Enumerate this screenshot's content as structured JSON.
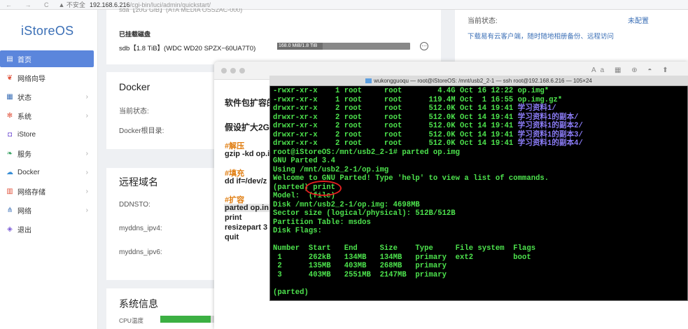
{
  "browser": {
    "nav": "← → C",
    "warning": "▲ 不安全",
    "url_host": "192.168.6.216",
    "url_path": "/cgi-bin/luci/admin/quickstart/"
  },
  "sidebar": {
    "logo": "iStoreOS",
    "items": [
      {
        "label": "首页",
        "icon": "home-icon",
        "glyph": "▤",
        "color": "#ffffff",
        "active": true,
        "chevron": false
      },
      {
        "label": "网络向导",
        "icon": "wizard-icon",
        "glyph": "❦",
        "color": "#e0513a",
        "active": false,
        "chevron": false
      },
      {
        "label": "状态",
        "icon": "status-icon",
        "glyph": "▦",
        "color": "#3b6fb6",
        "active": false,
        "chevron": true
      },
      {
        "label": "系统",
        "icon": "system-gear-icon",
        "glyph": "✻",
        "color": "#e0513a",
        "active": false,
        "chevron": true
      },
      {
        "label": "iStore",
        "icon": "istore-icon",
        "glyph": "◘",
        "color": "#7b5bd6",
        "active": false,
        "chevron": false
      },
      {
        "label": "服务",
        "icon": "service-icon",
        "glyph": "❧",
        "color": "#2e9d5b",
        "active": false,
        "chevron": true
      },
      {
        "label": "Docker",
        "icon": "docker-icon",
        "glyph": "☁",
        "color": "#3b8fd6",
        "active": false,
        "chevron": true
      },
      {
        "label": "网络存储",
        "icon": "storage-icon",
        "glyph": "▥",
        "color": "#e0513a",
        "active": false,
        "chevron": true
      },
      {
        "label": "网络",
        "icon": "network-icon",
        "glyph": "⋔",
        "color": "#3b6fb6",
        "active": false,
        "chevron": true
      },
      {
        "label": "退出",
        "icon": "logout-icon",
        "glyph": "◈",
        "color": "#7b5bd6",
        "active": false,
        "chevron": false
      }
    ],
    "chevron": "›"
  },
  "main": {
    "top_partial": "sda【20G GiB】(ATA MEDIA OSS2AC-000)",
    "mounted_title": "已挂载磁盘",
    "mounted_disk": "sdb【1.8 TiB】(WDC WD20 SPZX−60UA7T0)",
    "mounted_usage": "168.0 MiB/1.8 TiB",
    "mounted_usage_fraction": 0.34,
    "options_glyph": "⋯",
    "docker_title": "Docker",
    "docker_status_label": "当前状态:",
    "docker_root_label": "Docker根目录:",
    "domain_title": "远程域名",
    "ddnsto_label": "DDNSTO:",
    "ipv4_label": "myddns_ipv4:",
    "ipv6_label": "myddns_ipv6:",
    "sysinfo_title": "系统信息",
    "cpu_label": "CPU温度",
    "cpu_fraction": 0.9,
    "right_status_label": "当前状态:",
    "right_status_value": "未配置",
    "right_link": "下载易有云客户端，随时随地相册备份、远程访问"
  },
  "doc": {
    "line1": "软件包扩容的",
    "line2": "假设扩大2G",
    "h_unzip": "#解压",
    "cmd_gzip": "gzip -kd op.i",
    "h_fill": "#填充",
    "cmd_dd": "dd if=/dev/z",
    "h_expand": "#扩容",
    "cmd_parted": "parted op.in",
    "cmd_print": "print",
    "cmd_resize": "resizepart 3",
    "cmd_quit": "quit",
    "toolbar_right": "Aa ▦ ⊕ ◓ ⬆"
  },
  "terminal": {
    "title": "wukongguoqu — root@iStoreOS: /mnt/usb2_2-1 — ssh root@192.168.6.216 — 105×24",
    "lines": [
      {
        "text": "-rwxr-xr-x    1 root     root        4.4G Oct 16 12:22 op.img*",
        "blue": ""
      },
      {
        "text": "-rwxr-xr-x    1 root     root      119.4M Oct  1 16:55 op.img.gz*",
        "blue": ""
      },
      {
        "text": "drwxr-xr-x    2 root     root      512.0K Oct 14 19:41 ",
        "blue": "学习资料1/"
      },
      {
        "text": "drwxr-xr-x    2 root     root      512.0K Oct 14 19:41 ",
        "blue": "学习资料1的副本/"
      },
      {
        "text": "drwxr-xr-x    2 root     root      512.0K Oct 14 19:41 ",
        "blue": "学习资料1的副本2/"
      },
      {
        "text": "drwxr-xr-x    2 root     root      512.0K Oct 14 19:41 ",
        "blue": "学习资料1的副本3/"
      },
      {
        "text": "drwxr-xr-x    2 root     root      512.0K Oct 14 19:41 ",
        "blue": "学习资料1的副本4/"
      },
      {
        "text": "root@iStoreOS:/mnt/usb2_2-1# parted op.img",
        "blue": ""
      },
      {
        "text": "GNU Parted 3.4",
        "blue": ""
      },
      {
        "text": "Using /mnt/usb2_2-1/op.img",
        "blue": ""
      },
      {
        "text": "Welcome to GNU Parted! Type 'help' to view a list of commands.",
        "blue": ""
      },
      {
        "text": "(parted) print",
        "blue": ""
      },
      {
        "text": "Model:  (file)",
        "blue": ""
      },
      {
        "text": "Disk /mnt/usb2_2-1/op.img: 4698MB",
        "blue": ""
      },
      {
        "text": "Sector size (logical/physical): 512B/512B",
        "blue": ""
      },
      {
        "text": "Partition Table: msdos",
        "blue": ""
      },
      {
        "text": "Disk Flags:",
        "blue": ""
      },
      {
        "text": "",
        "blue": ""
      },
      {
        "text": "Number  Start   End     Size    Type     File system  Flags",
        "blue": ""
      },
      {
        "text": " 1      262kB   134MB   134MB   primary  ext2         boot",
        "blue": ""
      },
      {
        "text": " 2      135MB   403MB   268MB   primary",
        "blue": ""
      },
      {
        "text": " 3      403MB   2551MB  2147MB  primary",
        "blue": ""
      },
      {
        "text": "",
        "blue": ""
      },
      {
        "text": "(parted) ",
        "blue": ""
      }
    ]
  }
}
